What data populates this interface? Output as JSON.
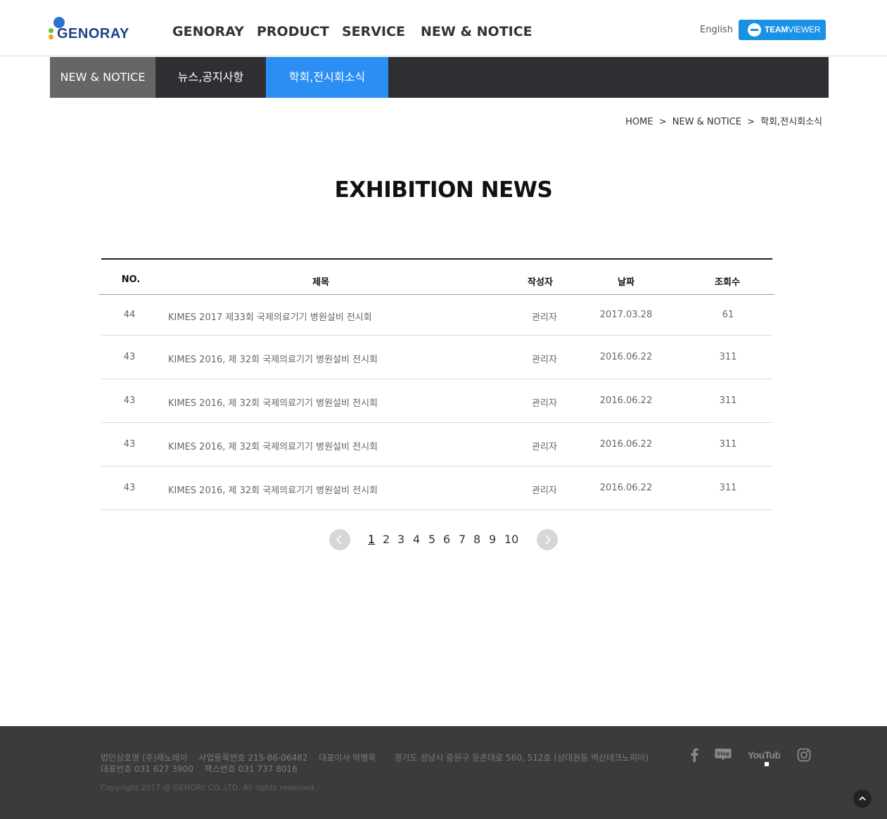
{
  "header": {
    "logo_text": "GENORAY",
    "nav": [
      "GENORAY",
      "PRODUCT",
      "SERVICE",
      "NEW & NOTICE"
    ],
    "lang_link": "English",
    "teamviewer": {
      "bold": "TEAM",
      "rest": "VIEWER"
    }
  },
  "subnav": {
    "category": "NEW & NOTICE",
    "tabs": [
      {
        "label": "뉴스,공지사항",
        "active": false
      },
      {
        "label": "학회,전시회소식",
        "active": true
      }
    ]
  },
  "breadcrumb": [
    "HOME",
    ">",
    "NEW & NOTICE",
    ">",
    "학회,전시회소식"
  ],
  "page_title": "EXHIBITION NEWS",
  "board": {
    "headers": {
      "no": "NO.",
      "title": "제목",
      "writer": "작성자",
      "date": "날짜",
      "hits": "조회수"
    },
    "rows": [
      {
        "no": "44",
        "title": "KIMES 2017 제33회 국제의료기기 병원설비 전시회",
        "writer": "관리자",
        "date": "2017.03.28",
        "hits": "61"
      },
      {
        "no": "43",
        "title": "KIMES 2016, 제 32회 국제의료기기 병원설비 전시회",
        "writer": "관리자",
        "date": "2016.06.22",
        "hits": "311"
      },
      {
        "no": "43",
        "title": "KIMES 2016, 제 32회 국제의료기기 병원설비 전시회",
        "writer": "관리자",
        "date": "2016.06.22",
        "hits": "311"
      },
      {
        "no": "43",
        "title": "KIMES 2016, 제 32회 국제의료기기 병원설비 전시회",
        "writer": "관리자",
        "date": "2016.06.22",
        "hits": "311"
      },
      {
        "no": "43",
        "title": "KIMES 2016, 제 32회 국제의료기기 병원설비 전시회",
        "writer": "관리자",
        "date": "2016.06.22",
        "hits": "311"
      }
    ]
  },
  "pagination": {
    "pages": [
      "1",
      "2",
      "3",
      "4",
      "5",
      "6",
      "7",
      "8",
      "9",
      "10"
    ],
    "current": "1"
  },
  "footer": {
    "company": "법인상호명 (주)제노레이",
    "biz_no": "사업등록번호 215-86-06482",
    "ceo": "대표이사 박병욱",
    "address": "경기도 성남시 중원구 둔촌대로 560, 512호 (상대원동 벽산테크노피아)",
    "tel": "대표번호 031 627 3900",
    "fax": "팩스번호 031 737 8016",
    "copyright": "Copyright 2017 @ GENORY CO.,LTD. All rights reserved.",
    "sns": [
      "facebook-icon",
      "blog-icon",
      "youtube-icon",
      "instagram-icon"
    ],
    "blog_label": "blog",
    "youtube_label": "YouTube"
  },
  "colors": {
    "accent": "#2b8ef2",
    "subnav_bg": "#2f2e33",
    "category_bg": "#666666",
    "footer_bg": "#3b3b3b",
    "teamviewer": "#1991e6"
  }
}
